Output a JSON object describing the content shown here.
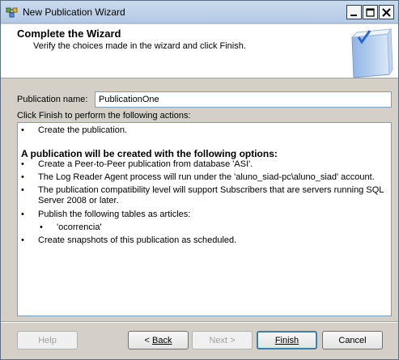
{
  "window": {
    "title": "New Publication Wizard",
    "icon": "wizard-app-icon"
  },
  "header": {
    "title": "Complete the Wizard",
    "subtitle": "Verify the choices made in the wizard and click Finish."
  },
  "form": {
    "publication_name_label": "Publication name:",
    "publication_name_value": "PublicationOne",
    "actions_label": "Click Finish to perform the following actions:"
  },
  "actions": {
    "bullet": "•",
    "create_pub": "Create the publication.",
    "options_heading": "A publication will be created with the following options:",
    "items": [
      "Create a Peer-to-Peer publication from database 'ASI'.",
      "The Log Reader Agent process will run under the 'aluno_siad-pc\\aluno_siad' account.",
      "The publication compatibility level will support Subscribers that are servers running SQL Server 2008 or later.",
      "Publish the following tables as articles:"
    ],
    "article": "'ocorrencia'",
    "snapshots": "Create snapshots of this publication as scheduled."
  },
  "buttons": {
    "help": "Help",
    "back_prefix": "< ",
    "back": "Back",
    "next": "Next >",
    "finish": "Finish",
    "cancel": "Cancel"
  }
}
